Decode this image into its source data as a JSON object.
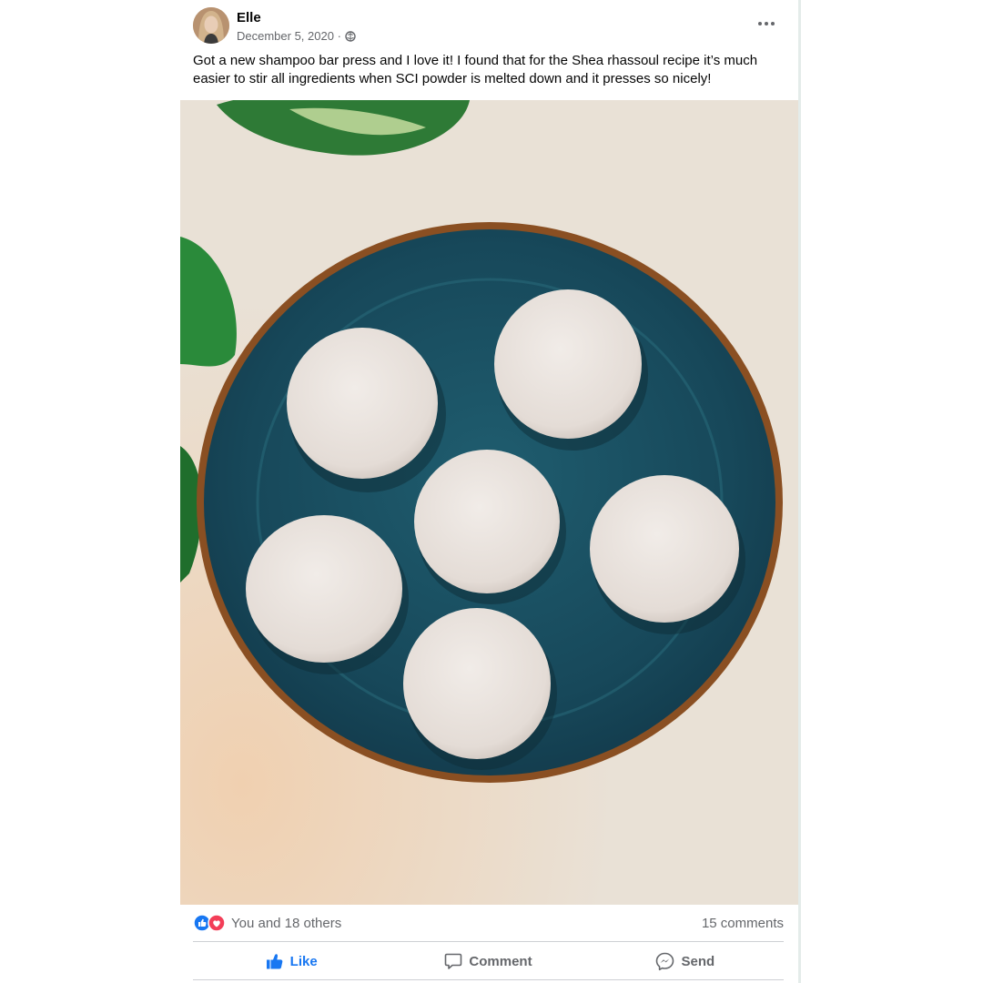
{
  "post": {
    "author": "Elle",
    "date": "December 5, 2020 ·",
    "audience_icon": "globe-icon",
    "caption": "Got a new shampoo bar press and I love it! I found that for the Shea rhassoul recipe it’s much easier to stir all ingredients when SCI powder is melted down and it presses so nicely!",
    "photo_subject": "five round shampoo bars on a teal plate"
  },
  "reactions": {
    "icons": [
      "like-reaction-icon",
      "love-reaction-icon"
    ],
    "summary": "You and 18 others",
    "comments": "15 comments"
  },
  "actions": {
    "like": "Like",
    "comment": "Comment",
    "send": "Send"
  },
  "colors": {
    "like_blue": "#1877f2",
    "love_red": "#f33e58",
    "plate_teal": "#1c5566",
    "counter_beige": "#e9e1d6"
  }
}
